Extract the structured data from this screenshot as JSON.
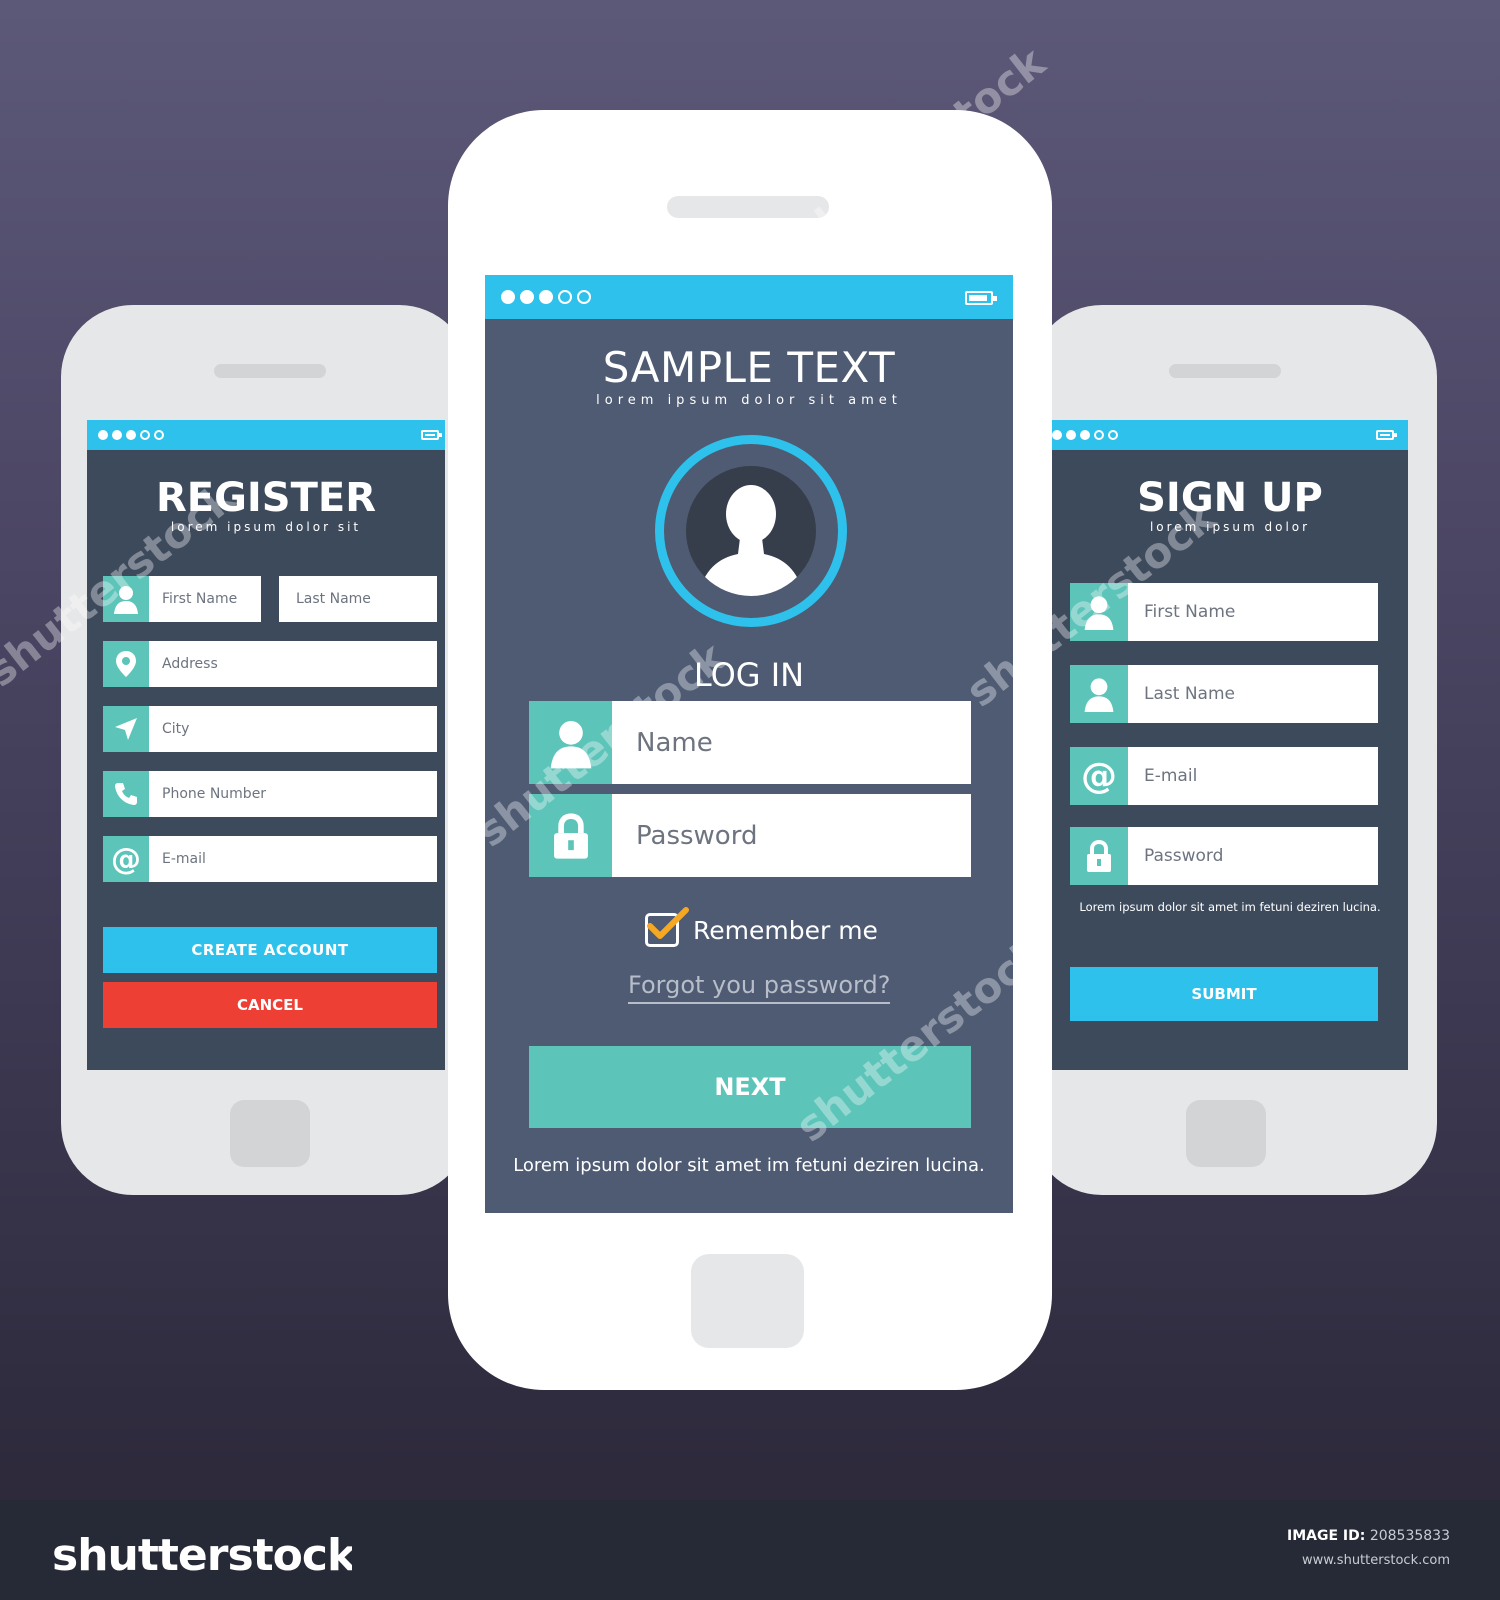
{
  "register": {
    "title": "REGISTER",
    "subtitle": "lorem ipsum dolor sit",
    "first_name_placeholder": "First Name",
    "last_name_placeholder": "Last Name",
    "address_placeholder": "Address",
    "city_placeholder": "City",
    "phone_placeholder": "Phone Number",
    "email_placeholder": "E-mail",
    "create_label": "CREATE ACCOUNT",
    "cancel_label": "CANCEL"
  },
  "login": {
    "title": "SAMPLE TEXT",
    "subtitle": "lorem ipsum dolor sit amet",
    "heading": "LOG IN",
    "name_placeholder": "Name",
    "password_placeholder": "Password",
    "remember_label": "Remember me",
    "remember_checked": true,
    "forgot_link": "Forgot you password?",
    "next_label": "NEXT",
    "footer_text": "Lorem ipsum dolor sit amet im fetuni deziren lucina."
  },
  "signup": {
    "title": "SIGN UP",
    "subtitle": "lorem ipsum dolor",
    "first_name_placeholder": "First Name",
    "last_name_placeholder": "Last Name",
    "email_placeholder": "E-mail",
    "password_placeholder": "Password",
    "note_text": "Lorem ipsum dolor sit amet im fetuni deziren lucina.",
    "submit_label": "SUBMIT"
  },
  "status_bar": {
    "signal_filled": 3,
    "signal_empty": 2
  },
  "branding": {
    "logo": "shutterstock",
    "watermark": "shutterstock",
    "image_id_label": "IMAGE ID:",
    "image_id_value": "208535833",
    "site": "www.shutterstock.com"
  },
  "colors": {
    "accent_blue": "#2ec1ec",
    "teal": "#5dc4b9",
    "danger_red": "#ee3f34",
    "screen_dark": "#3d4a5c",
    "screen_center": "#4e5b73",
    "checkmark_orange": "#f7a823"
  },
  "icons": {
    "user": "user-icon",
    "location": "map-pin-icon",
    "city": "navigation-arrow-icon",
    "phone": "phone-icon",
    "email": "at-sign-icon",
    "lock": "lock-icon",
    "check": "checkbox-checked-icon",
    "battery": "battery-icon"
  }
}
